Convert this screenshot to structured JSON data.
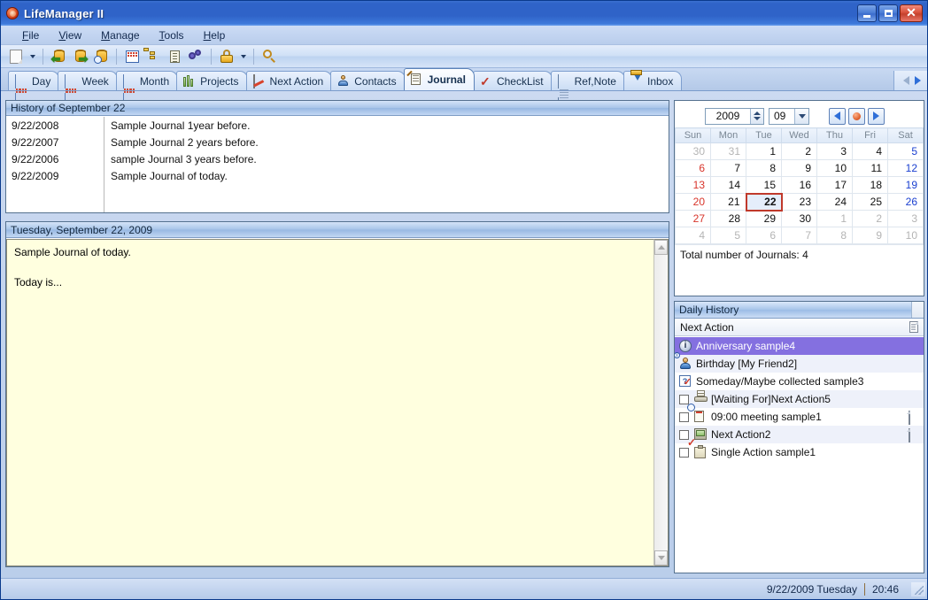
{
  "window": {
    "title": "LifeManager II",
    "app_icon": "app-logo-icon",
    "minimize_label": "_",
    "maximize_label": "□",
    "close_label": "✕"
  },
  "menubar": {
    "items": [
      {
        "label": "File",
        "accel": "F"
      },
      {
        "label": "View",
        "accel": "V"
      },
      {
        "label": "Manage",
        "accel": "M"
      },
      {
        "label": "Tools",
        "accel": "T"
      },
      {
        "label": "Help",
        "accel": "H"
      }
    ]
  },
  "toolbar": {
    "buttons": [
      {
        "name": "new-document-icon"
      },
      {
        "name": "new-document-dropdown-arrow"
      },
      {
        "name": "import-database-icon"
      },
      {
        "name": "export-database-icon"
      },
      {
        "name": "database-history-icon"
      },
      {
        "name": "calendar-icon"
      },
      {
        "name": "tree-view-icon"
      },
      {
        "name": "list-view-icon"
      },
      {
        "name": "settings-gears-icon"
      },
      {
        "name": "lock-icon"
      },
      {
        "name": "lock-dropdown-arrow"
      },
      {
        "name": "search-icon"
      }
    ]
  },
  "tabs": {
    "items": [
      {
        "label": "Day",
        "icon": "day-calendar-icon",
        "active": false
      },
      {
        "label": "Week",
        "icon": "week-calendar-icon",
        "active": false
      },
      {
        "label": "Month",
        "icon": "month-calendar-icon",
        "active": false
      },
      {
        "label": "Projects",
        "icon": "projects-icon",
        "active": false
      },
      {
        "label": "Next Action",
        "icon": "next-action-icon",
        "active": false
      },
      {
        "label": "Contacts",
        "icon": "contacts-icon",
        "active": false
      },
      {
        "label": "Journal",
        "icon": "journal-icon",
        "active": true
      },
      {
        "label": "CheckList",
        "icon": "checklist-icon",
        "active": false
      },
      {
        "label": "Ref,Note",
        "icon": "refnote-icon",
        "active": false
      },
      {
        "label": "Inbox",
        "icon": "inbox-icon",
        "active": false
      }
    ],
    "nav_prev": "scroll-tabs-left-icon",
    "nav_next": "scroll-tabs-right-icon"
  },
  "history": {
    "title": "History of September 22",
    "rows": [
      {
        "date": "9/22/2008",
        "text": "Sample Journal 1year before."
      },
      {
        "date": "9/22/2007",
        "text": "Sample Journal 2 years before."
      },
      {
        "date": "9/22/2006",
        "text": "sample Journal 3 years before."
      },
      {
        "date": "9/22/2009",
        "text": "Sample Journal of today."
      }
    ]
  },
  "journal": {
    "title": "Tuesday, September 22, 2009",
    "body_line1": "Sample Journal of today.",
    "body_line2": "Today is...",
    "background_color": "#ffffdf"
  },
  "calendar": {
    "year": "2009",
    "month": "09",
    "prev_label": "prev-month",
    "today_label": "today",
    "next_label": "next-month",
    "weekdays": [
      "Sun",
      "Mon",
      "Tue",
      "Wed",
      "Thu",
      "Fri",
      "Sat"
    ],
    "weeks": [
      [
        {
          "d": "30",
          "cls": "other"
        },
        {
          "d": "31",
          "cls": "other"
        },
        {
          "d": "1",
          "cls": ""
        },
        {
          "d": "2",
          "cls": ""
        },
        {
          "d": "3",
          "cls": ""
        },
        {
          "d": "4",
          "cls": ""
        },
        {
          "d": "5",
          "cls": "sat"
        }
      ],
      [
        {
          "d": "6",
          "cls": "sun"
        },
        {
          "d": "7",
          "cls": ""
        },
        {
          "d": "8",
          "cls": ""
        },
        {
          "d": "9",
          "cls": ""
        },
        {
          "d": "10",
          "cls": ""
        },
        {
          "d": "11",
          "cls": ""
        },
        {
          "d": "12",
          "cls": "sat"
        }
      ],
      [
        {
          "d": "13",
          "cls": "sun"
        },
        {
          "d": "14",
          "cls": ""
        },
        {
          "d": "15",
          "cls": ""
        },
        {
          "d": "16",
          "cls": ""
        },
        {
          "d": "17",
          "cls": ""
        },
        {
          "d": "18",
          "cls": ""
        },
        {
          "d": "19",
          "cls": "sat"
        }
      ],
      [
        {
          "d": "20",
          "cls": "sun"
        },
        {
          "d": "21",
          "cls": ""
        },
        {
          "d": "22",
          "cls": "sel"
        },
        {
          "d": "23",
          "cls": ""
        },
        {
          "d": "24",
          "cls": ""
        },
        {
          "d": "25",
          "cls": ""
        },
        {
          "d": "26",
          "cls": "sat"
        }
      ],
      [
        {
          "d": "27",
          "cls": "sun"
        },
        {
          "d": "28",
          "cls": ""
        },
        {
          "d": "29",
          "cls": ""
        },
        {
          "d": "30",
          "cls": ""
        },
        {
          "d": "1",
          "cls": "other"
        },
        {
          "d": "2",
          "cls": "other"
        },
        {
          "d": "3",
          "cls": "other"
        }
      ],
      [
        {
          "d": "4",
          "cls": "other"
        },
        {
          "d": "5",
          "cls": "other"
        },
        {
          "d": "6",
          "cls": "other"
        },
        {
          "d": "7",
          "cls": "other"
        },
        {
          "d": "8",
          "cls": "other"
        },
        {
          "d": "9",
          "cls": "other"
        },
        {
          "d": "10",
          "cls": "other"
        }
      ]
    ],
    "total_text": "Total number of Journals: 4"
  },
  "daily_history": {
    "title": "Daily History",
    "column_header": "Next Action",
    "column_note_icon": "note-icon",
    "rows": [
      {
        "label": "Anniversary sample4",
        "icon": "info-icon",
        "checkbox": false,
        "note": false,
        "selected": true
      },
      {
        "label": "Birthday [My Friend2]",
        "icon": "contact-icon",
        "checkbox": false,
        "note": false,
        "selected": false
      },
      {
        "label": "Someday/Maybe collected sample3",
        "icon": "someday-icon",
        "checkbox": false,
        "note": false,
        "selected": false
      },
      {
        "label": "[Waiting For]Next Action5",
        "icon": "waiting-icon",
        "checkbox": true,
        "note": false,
        "selected": false
      },
      {
        "label": "09:00 meeting sample1",
        "icon": "scheduled-icon",
        "checkbox": true,
        "note": true,
        "selected": false
      },
      {
        "label": "Next Action2",
        "icon": "computer-icon",
        "checkbox": true,
        "note": true,
        "selected": false
      },
      {
        "label": "Single Action sample1",
        "icon": "single-action-icon",
        "checkbox": true,
        "note": false,
        "selected": false
      }
    ],
    "selection_color": "#8470e0"
  },
  "statusbar": {
    "date": "9/22/2009 Tuesday",
    "time": "20:46"
  }
}
